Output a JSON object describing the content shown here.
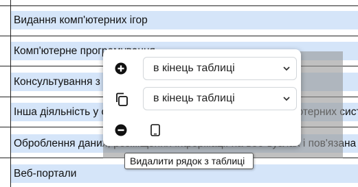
{
  "table": {
    "rows": [
      "Видання комп'ютерних ігор",
      "Комп'ютерне програмування",
      "Консультування з питань інформатизації",
      "Інша діяльність у сфері інформаційних технологій і комп'ютерних систем",
      "Оброблення даних, розміщення інформації на веб-вузлах і пов'язана з ними діяльність",
      "Веб-портали"
    ]
  },
  "popup": {
    "add_position": "в кінець таблиці",
    "copy_position": "в кінець таблиці"
  },
  "tooltip": "Видалити рядок з таблиці",
  "colors": {
    "row_bg": "#d5e5f9",
    "grid": "#222222"
  }
}
